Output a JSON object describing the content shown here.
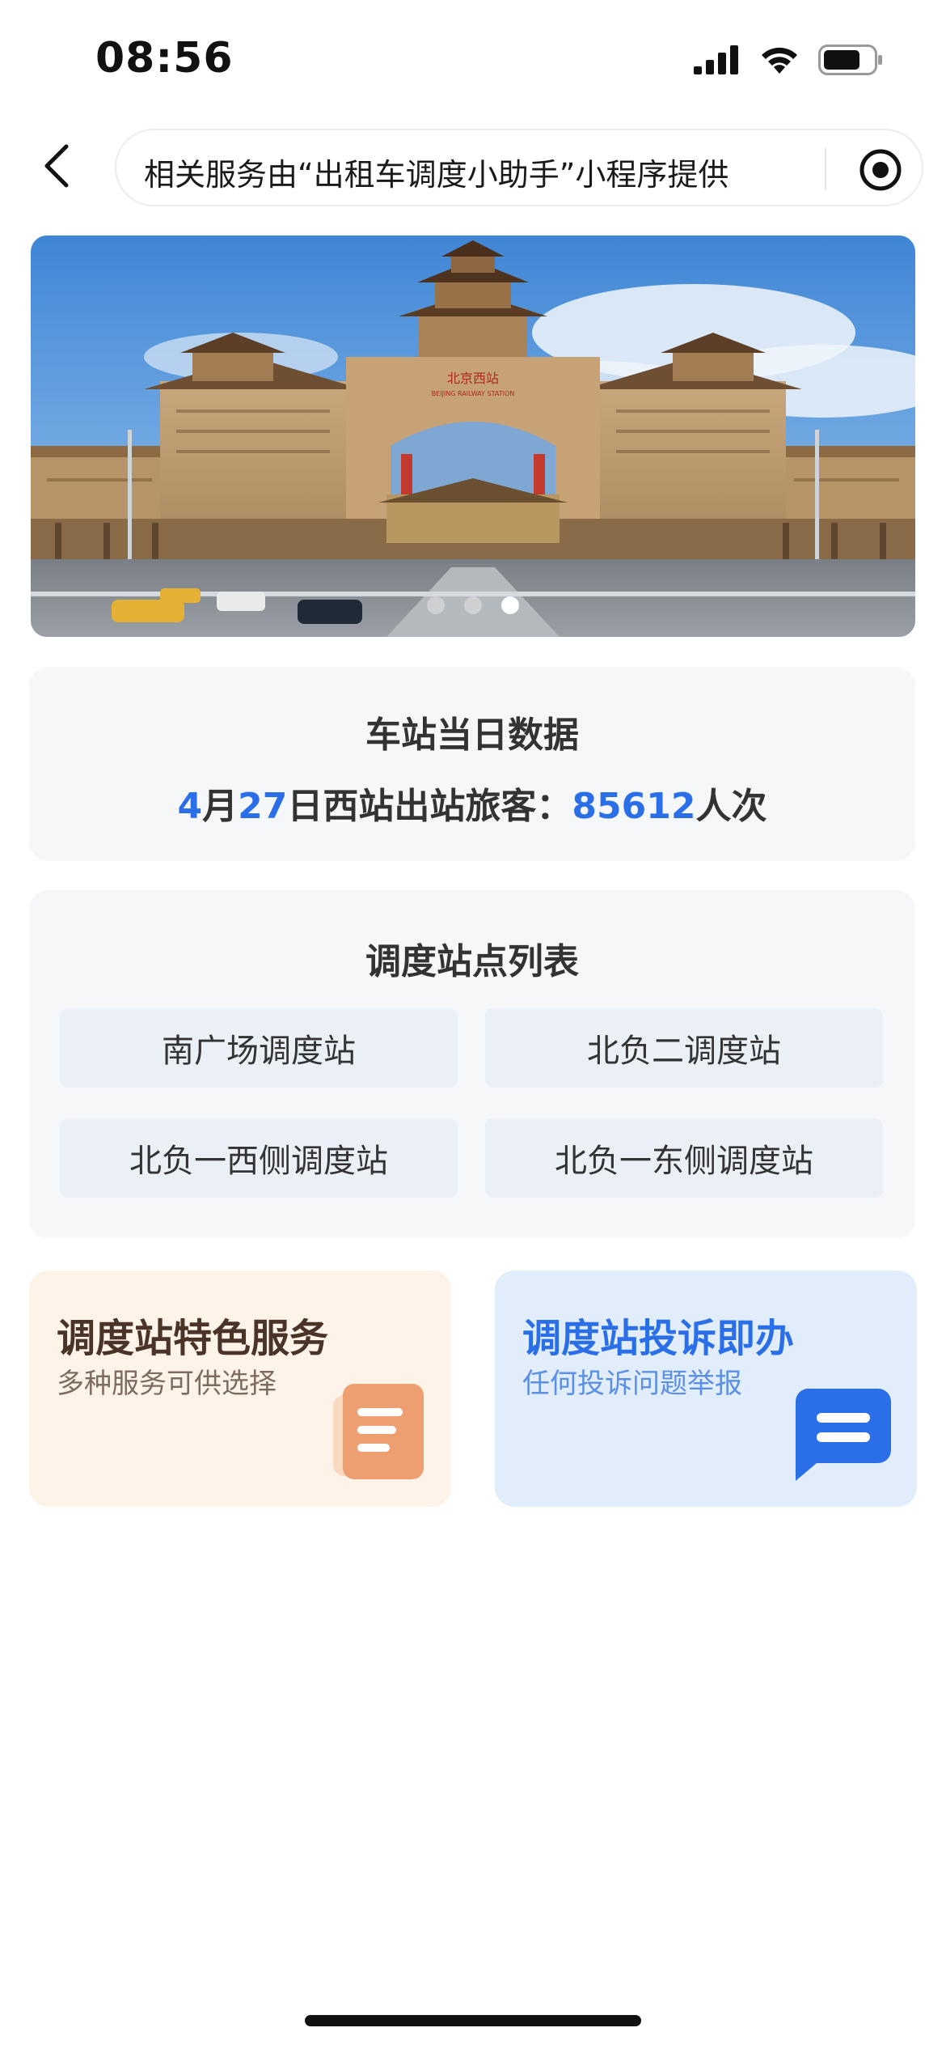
{
  "status": {
    "time": "08:56"
  },
  "nav": {
    "notice": "相关服务由“出租车调度小助手”小程序提供"
  },
  "banner": {
    "sign_text": "北京西站",
    "sign_sub": "BEIJING RAILWAY STATION",
    "slides": 3,
    "active_slide": 3
  },
  "stats": {
    "title": "车站当日数据",
    "month": "4",
    "month_unit": "月",
    "day": "27",
    "day_text": "日西站出站旅客：",
    "count": "85612",
    "count_unit": "人次"
  },
  "stations": {
    "title": "调度站点列表",
    "items": [
      {
        "label": "南广场调度站"
      },
      {
        "label": "北负二调度站"
      },
      {
        "label": "北负一西侧调度站"
      },
      {
        "label": "北负一东侧调度站"
      }
    ]
  },
  "features": [
    {
      "title": "调度站特色服务",
      "subtitle": "多种服务可供选择",
      "icon": "document-icon",
      "color": "#f0a679"
    },
    {
      "title": "调度站投诉即办",
      "subtitle": "任何投诉问题举报",
      "icon": "chat-icon",
      "color": "#2b6fe8"
    }
  ],
  "colors": {
    "accent": "#2b6fe8",
    "card_bg": "#f6f7f9",
    "station_bg": "#ebf0f7"
  }
}
